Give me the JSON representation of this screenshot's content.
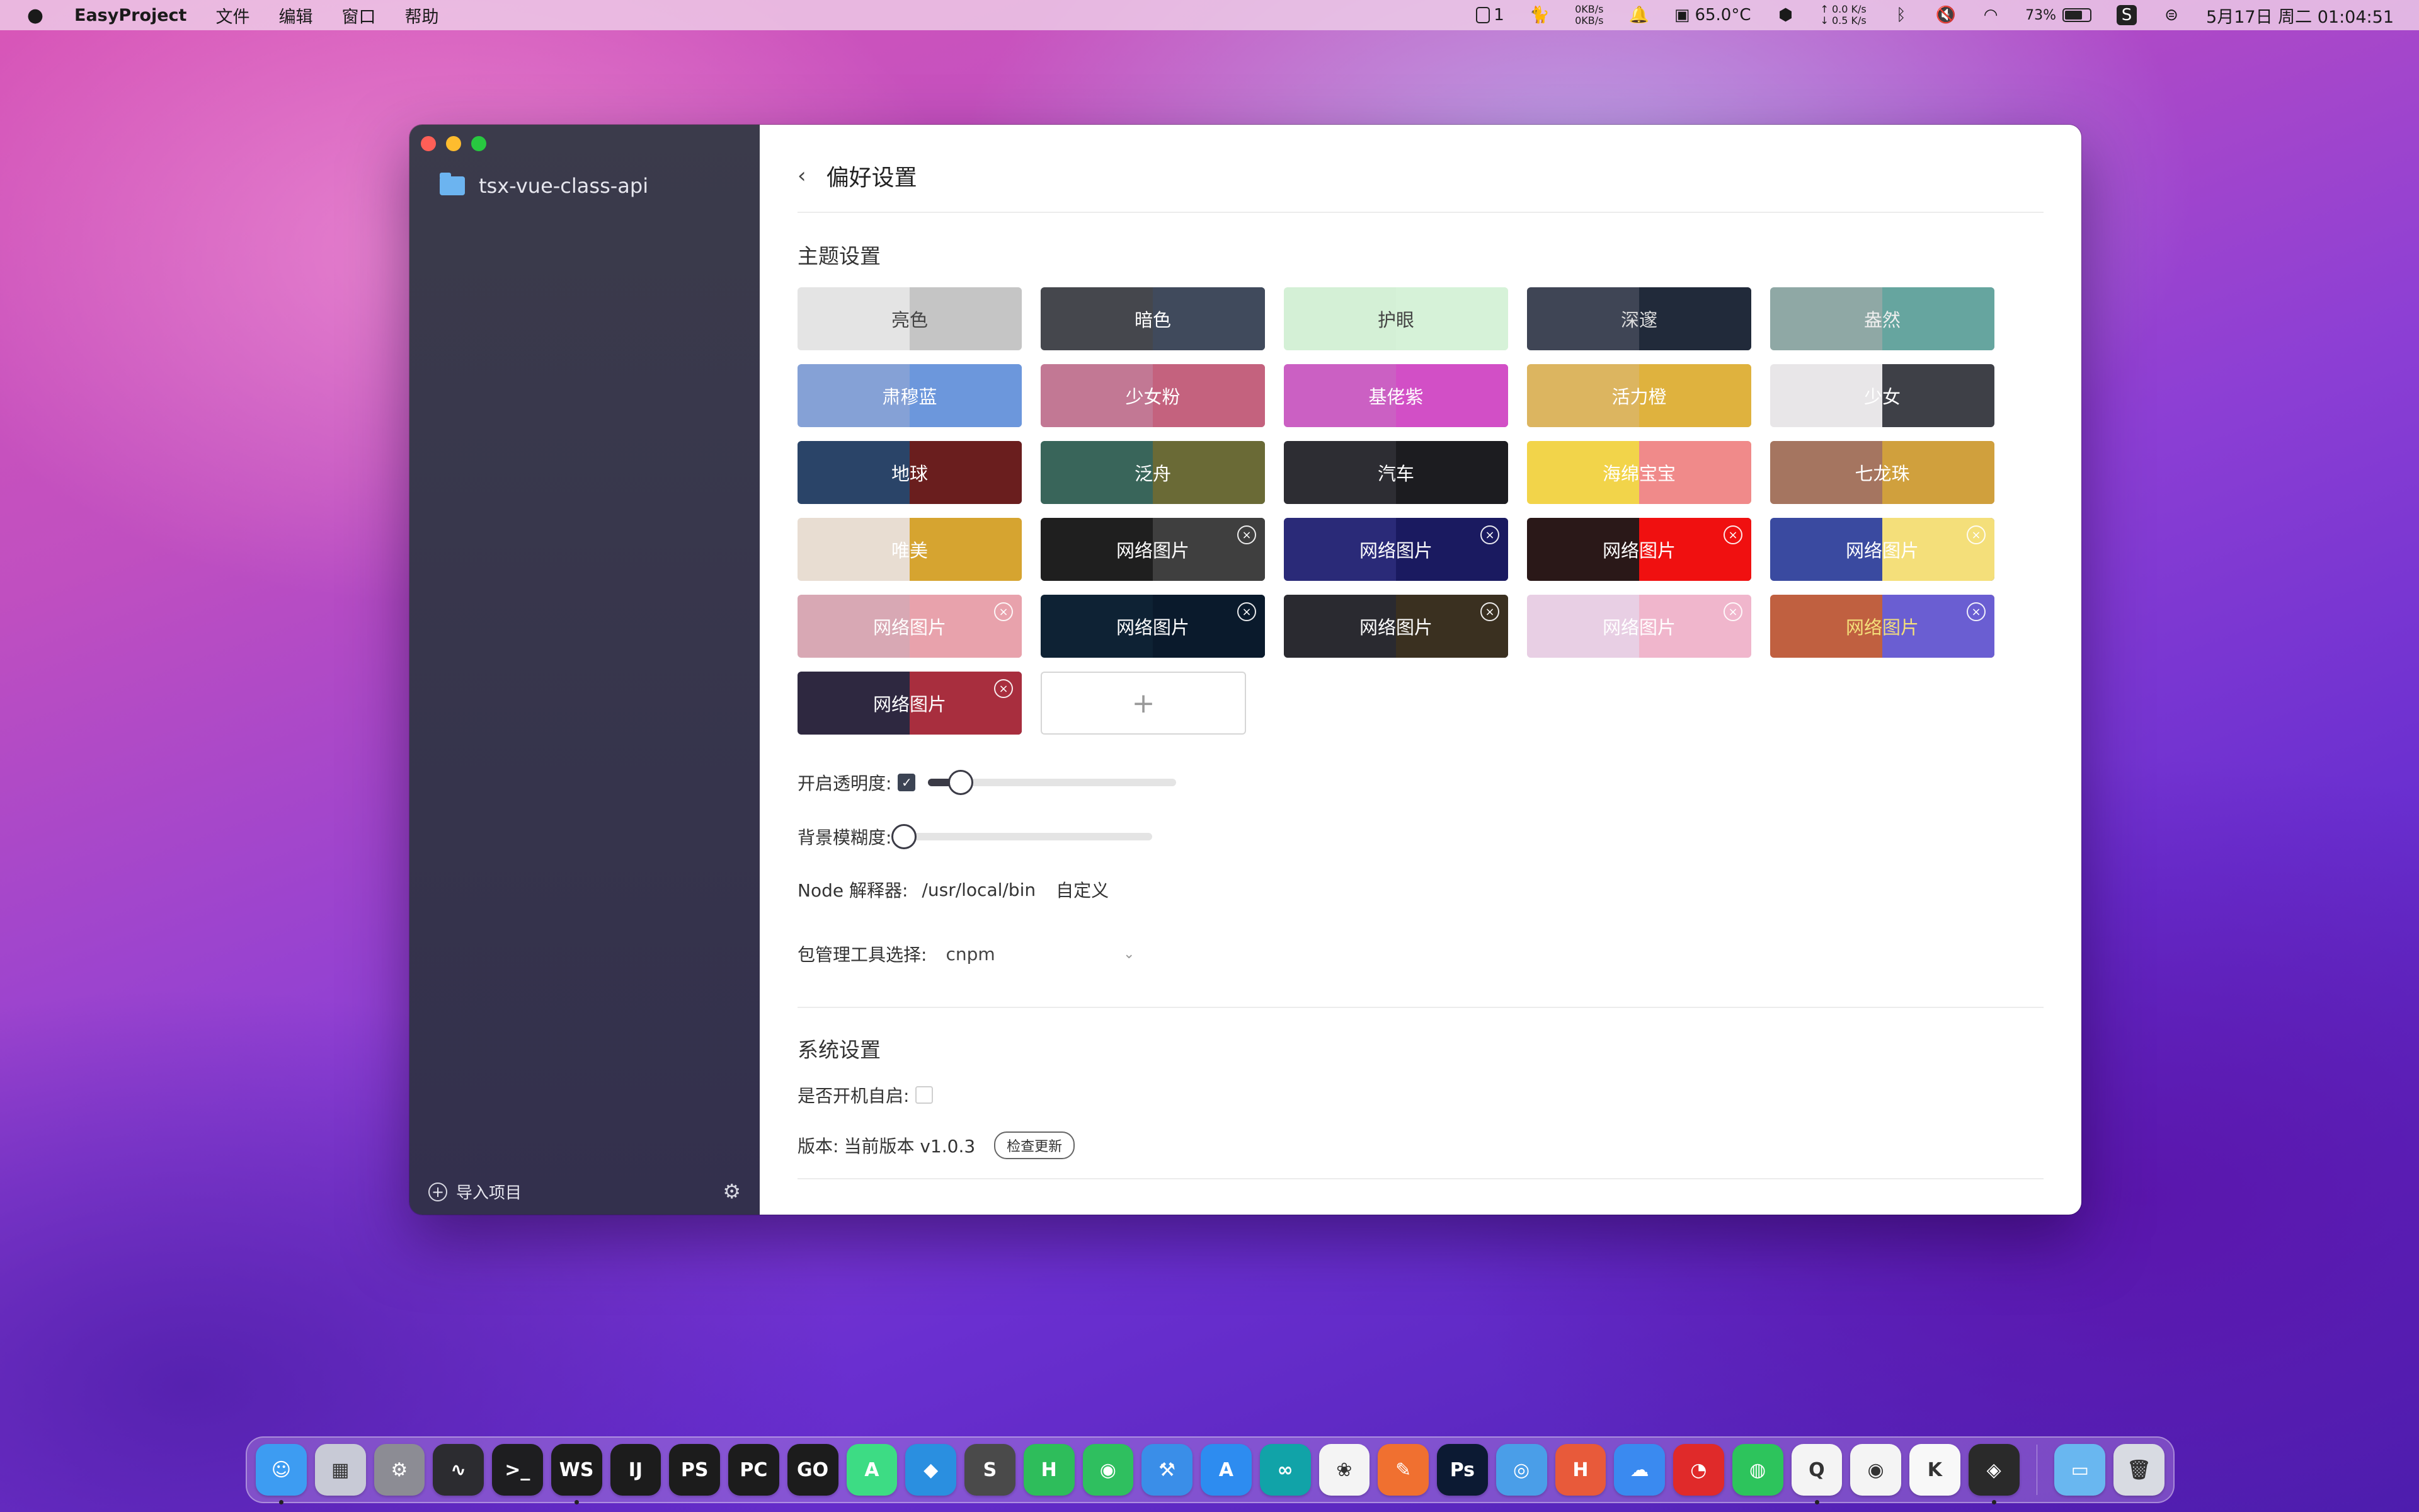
{
  "menubar": {
    "app_name": "EasyProject",
    "menus": [
      "文件",
      "编辑",
      "窗口",
      "帮助"
    ],
    "badge_count": "1",
    "net_up": "0KB/s",
    "net_down": "0KB/s",
    "temperature": "65.0°C",
    "speed_up": "↑ 0.0 K/s",
    "speed_down": "↓ 0.5 K/s",
    "battery_percent": "73%",
    "battery_level": 0.73,
    "datetime": "5月17日 周二  01:04:51"
  },
  "sidebar": {
    "project_name": "tsx-vue-class-api",
    "import_label": "导入项目"
  },
  "main": {
    "page_title": "偏好设置",
    "theme_section_title": "主题设置",
    "themes": [
      {
        "label": "亮色",
        "left": "#e4e4e4",
        "right": "#c5c5c5",
        "text_color": "#444444",
        "removable": false
      },
      {
        "label": "暗色",
        "left": "#45474d",
        "right": "#404a5c",
        "text_color": "#ffffff",
        "removable": false
      },
      {
        "label": "护眼",
        "left": "#d4f0d6",
        "right": "#d6f2d8",
        "text_color": "#444444",
        "removable": false
      },
      {
        "label": "深邃",
        "left": "#3f4555",
        "right": "#212a3a",
        "text_color": "#dddddd",
        "removable": false
      },
      {
        "label": "盎然",
        "left": "#8fa8a5",
        "right": "#66a59f",
        "text_color": "#eeeeee",
        "removable": false
      },
      {
        "label": "肃穆蓝",
        "left": "#85a1d6",
        "right": "#6c97dc",
        "text_color": "#ffffff",
        "removable": false
      },
      {
        "label": "少女粉",
        "left": "#c27894",
        "right": "#c4627e",
        "text_color": "#ffffff",
        "removable": false
      },
      {
        "label": "基佬紫",
        "left": "#cb60c3",
        "right": "#d24fc6",
        "text_color": "#ffffff",
        "removable": false
      },
      {
        "label": "活力橙",
        "left": "#dcb560",
        "right": "#dfb23e",
        "text_color": "#ffffff",
        "removable": false
      },
      {
        "label": "少女",
        "left": "#e8e6e8",
        "right": "#3e4047",
        "text_color": "#ffffff",
        "removable": false
      },
      {
        "label": "地球",
        "left": "#2a4468",
        "right": "#6a1e1e",
        "text_color": "#ffffff",
        "removable": false
      },
      {
        "label": "泛舟",
        "left": "#39655a",
        "right": "#6a6a36",
        "text_color": "#ffffff",
        "removable": false
      },
      {
        "label": "汽车",
        "left": "#2d2d33",
        "right": "#1c1c20",
        "text_color": "#ffffff",
        "removable": false
      },
      {
        "label": "海绵宝宝",
        "left": "#f2d44a",
        "right": "#f08a8a",
        "text_color": "#ffffff",
        "removable": false
      },
      {
        "label": "七龙珠",
        "left": "#a57560",
        "right": "#d0a03d",
        "text_color": "#ffffff",
        "removable": false
      },
      {
        "label": "唯美",
        "left": "#e8ddd2",
        "right": "#d6a430",
        "text_color": "#ffffff",
        "removable": false
      },
      {
        "label": "网络图片",
        "left": "#1f1f1f",
        "right": "#3f3f3f",
        "text_color": "#ffffff",
        "removable": true
      },
      {
        "label": "网络图片",
        "left": "#2a2a78",
        "right": "#1a1a60",
        "text_color": "#ffffff",
        "removable": true
      },
      {
        "label": "网络图片",
        "left": "#2a1818",
        "right": "#f01010",
        "text_color": "#ffffff",
        "removable": true
      },
      {
        "label": "网络图片",
        "left": "#3a4aa0",
        "right": "#f4df7a",
        "text_color": "#ffffff",
        "removable": true
      },
      {
        "label": "网络图片",
        "left": "#d8a8b4",
        "right": "#e8a2ac",
        "text_color": "#ffffff",
        "removable": true
      },
      {
        "label": "网络图片",
        "left": "#0e2234",
        "right": "#0a1a2c",
        "text_color": "#ffffff",
        "removable": true
      },
      {
        "label": "网络图片",
        "left": "#2a2a30",
        "right": "#3a3020",
        "text_color": "#ffffff",
        "removable": true
      },
      {
        "label": "网络图片",
        "left": "#e8cfe4",
        "right": "#f0b6cc",
        "text_color": "#ffffff",
        "removable": true
      },
      {
        "label": "网络图片",
        "left": "#c06040",
        "right": "#6a5ed2",
        "text_color": "#f4df7a",
        "removable": true
      },
      {
        "label": "网络图片",
        "left": "#2e2840",
        "right": "#a82e3e",
        "text_color": "#ffffff",
        "removable": true
      }
    ],
    "add_theme_symbol": "+",
    "opacity": {
      "label": "开启透明度:",
      "checked": true,
      "value": 0.13
    },
    "blur": {
      "label": "背景模糊度:",
      "value": 0.0
    },
    "node": {
      "label": "Node 解释器:",
      "path": "/usr/local/bin",
      "custom_label": "自定义"
    },
    "package_manager": {
      "label": "包管理工具选择:",
      "selected": "cnpm"
    },
    "system_section_title": "系统设置",
    "autostart_label": "是否开机自启:",
    "autostart_checked": false,
    "version_label": "版本:",
    "version_text": "当前版本 v1.0.3",
    "check_update_label": "检查更新"
  },
  "dock": {
    "apps": [
      {
        "name": "finder",
        "glyph": "☺",
        "color": "#3d9cf2",
        "running": true
      },
      {
        "name": "launchpad",
        "glyph": "▦",
        "color": "#c8cad6",
        "running": false
      },
      {
        "name": "system-preferences",
        "glyph": "⚙",
        "color": "#8c8c94",
        "running": false
      },
      {
        "name": "activity-monitor",
        "glyph": "∿",
        "color": "#2c2c30",
        "running": false
      },
      {
        "name": "terminal",
        "glyph": ">_",
        "color": "#1e1e20",
        "running": false
      },
      {
        "name": "webstorm",
        "glyph": "WS",
        "color": "#1c1c1c",
        "running": true
      },
      {
        "name": "intellij",
        "glyph": "IJ",
        "color": "#1c1c1c",
        "running": false
      },
      {
        "name": "phpstorm",
        "glyph": "PS",
        "color": "#1c1c1c",
        "running": false
      },
      {
        "name": "pycharm",
        "glyph": "PC",
        "color": "#1c1c1c",
        "running": false
      },
      {
        "name": "goland",
        "glyph": "GO",
        "color": "#1c1c1c",
        "running": false
      },
      {
        "name": "android-studio",
        "glyph": "A",
        "color": "#3ddc84",
        "running": false
      },
      {
        "name": "vscode",
        "glyph": "◆",
        "color": "#2a8fe0",
        "running": false
      },
      {
        "name": "sublime-text",
        "glyph": "S",
        "color": "#4a4a4a",
        "running": false
      },
      {
        "name": "hbuilder",
        "glyph": "H",
        "color": "#2ebd5b",
        "running": false
      },
      {
        "name": "wechat-devtools",
        "glyph": "◉",
        "color": "#2fbf5f",
        "running": false
      },
      {
        "name": "xcode",
        "glyph": "⚒",
        "color": "#3a8ee8",
        "running": false
      },
      {
        "name": "app-store",
        "glyph": "A",
        "color": "#2d8cf0",
        "running": false
      },
      {
        "name": "arduino",
        "glyph": "∞",
        "color": "#11a3a8",
        "running": false
      },
      {
        "name": "mind-node",
        "glyph": "❀",
        "color": "#f4f4f4",
        "running": false
      },
      {
        "name": "sketch-pen",
        "glyph": "✎",
        "color": "#f07030",
        "running": false
      },
      {
        "name": "photoshop",
        "glyph": "Ps",
        "color": "#0c1a33",
        "running": false
      },
      {
        "name": "database",
        "glyph": "◎",
        "color": "#4a9ee8",
        "running": false
      },
      {
        "name": "html-tool",
        "glyph": "H",
        "color": "#e85a3a",
        "running": false
      },
      {
        "name": "cloud-app",
        "glyph": "☁",
        "color": "#3a8af0",
        "running": false
      },
      {
        "name": "netease-music",
        "glyph": "◔",
        "color": "#e02a2a",
        "running": false
      },
      {
        "name": "wechat",
        "glyph": "◍",
        "color": "#2dc45c",
        "running": false
      },
      {
        "name": "qq",
        "glyph": "Q",
        "color": "#f4f4f4",
        "running": true
      },
      {
        "name": "chrome",
        "glyph": "◉",
        "color": "#f4f4f4",
        "running": false
      },
      {
        "name": "kuaishou",
        "glyph": "K",
        "color": "#f8f8f8",
        "running": false
      },
      {
        "name": "easyproject",
        "glyph": "◈",
        "color": "#2a2a2a",
        "running": true
      }
    ],
    "right_apps": [
      {
        "name": "downloads-folder",
        "glyph": "▭",
        "color": "#69b7f0"
      },
      {
        "name": "trash",
        "glyph": "🗑",
        "color": "#d8dbe2"
      }
    ]
  }
}
